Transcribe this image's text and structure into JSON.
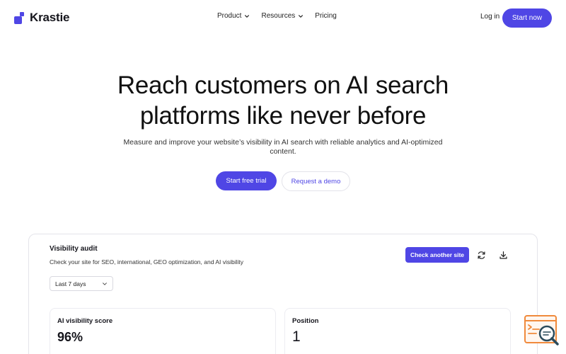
{
  "brand": {
    "name": "Krastie",
    "accent": "#4f46e5"
  },
  "nav": {
    "items": [
      {
        "label": "Product",
        "has_dropdown": true
      },
      {
        "label": "Resources",
        "has_dropdown": true
      },
      {
        "label": "Pricing",
        "has_dropdown": false
      }
    ],
    "login_label": "Log in",
    "start_now_label": "Start now"
  },
  "hero": {
    "title_line1": "Reach customers on AI search",
    "title_line2": "platforms like never before",
    "subtitle": "Measure and improve your website’s visibility in AI search with reliable analytics and AI-optimized content.",
    "primary_cta": "Start free trial",
    "secondary_cta": "Request a demo"
  },
  "audit": {
    "title": "Visibility audit",
    "subtitle": "Check your site for SEO, international, GEO optimization, and AI visibility",
    "period_selected": "Last 7 days",
    "check_button": "Check another site",
    "icons": [
      "refresh-icon",
      "download-icon"
    ],
    "metrics": [
      {
        "label": "AI visibility score",
        "value": "96%"
      },
      {
        "label": "Position",
        "value": "1"
      }
    ]
  },
  "widget": {
    "icon": "search-analytics-icon",
    "color": "#f08a3c"
  }
}
